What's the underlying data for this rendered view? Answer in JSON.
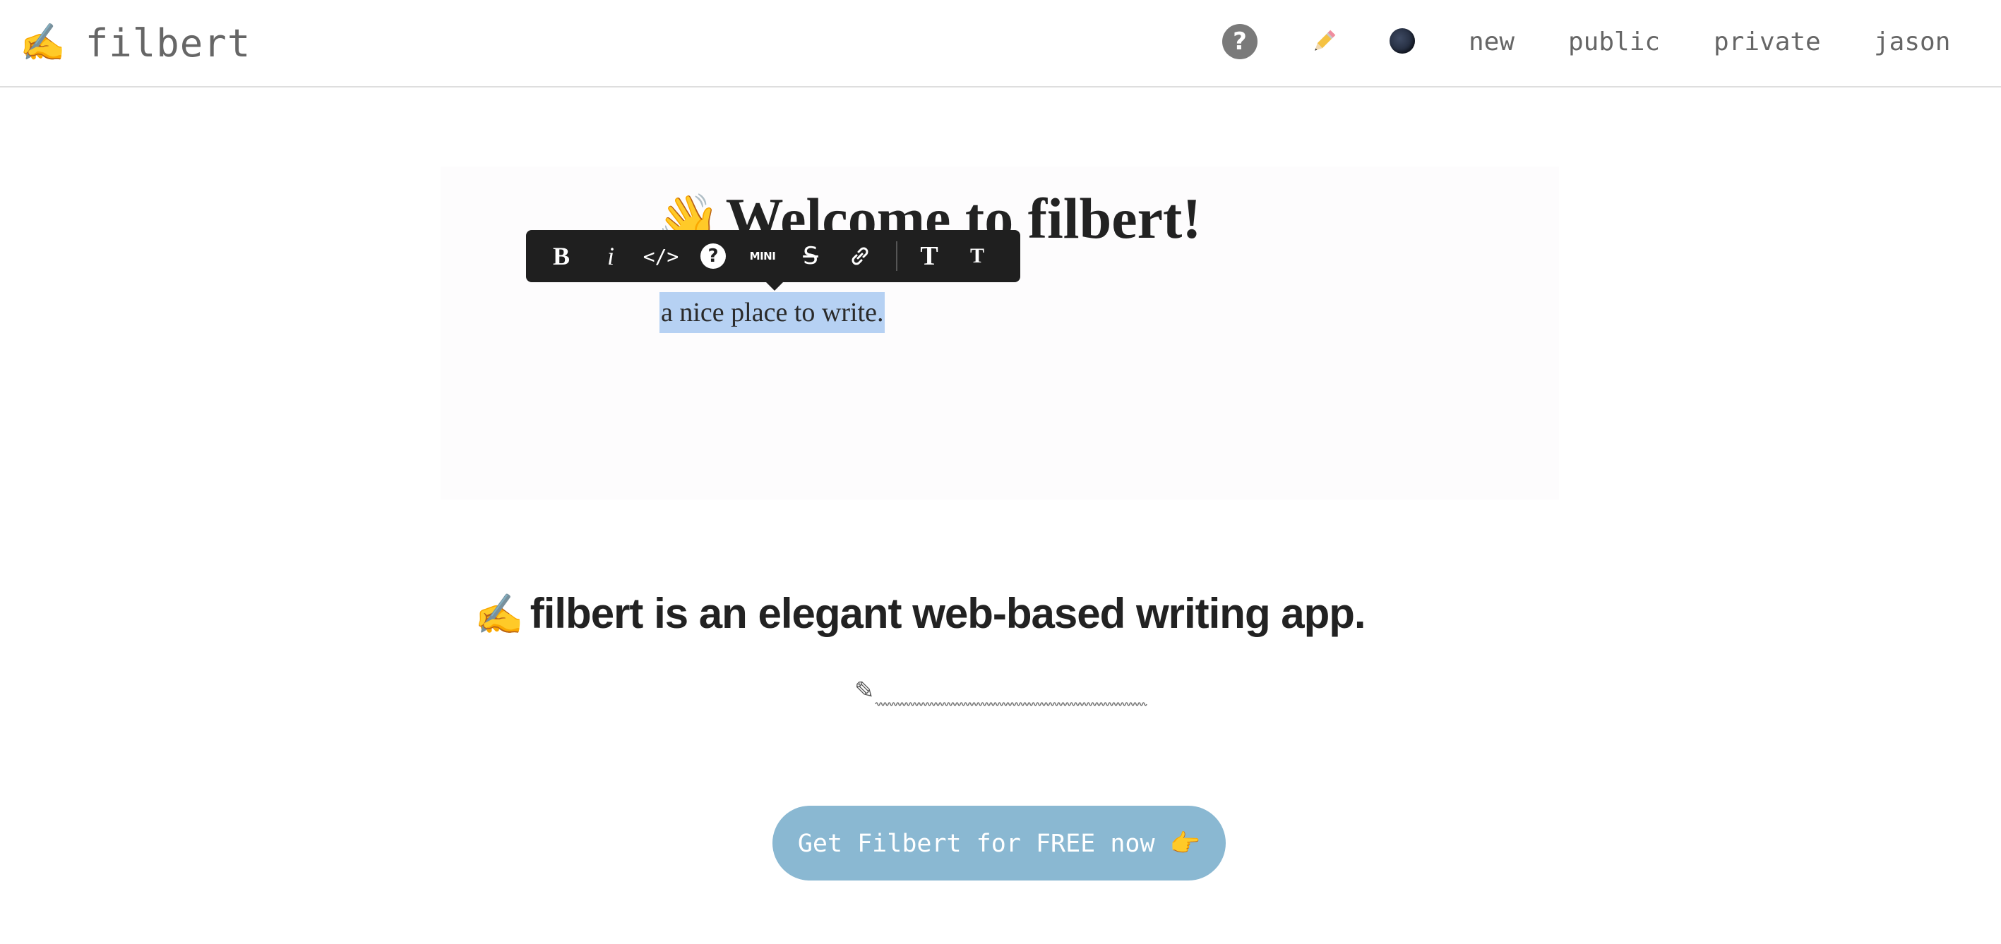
{
  "header": {
    "logo_emoji": "✍️",
    "logo_text": "filbert",
    "help_icon_glyph": "?",
    "pencil_icon_glyph": "✏️",
    "nav": {
      "new": "new",
      "public": "public",
      "private": "private",
      "user": "jason"
    }
  },
  "preview": {
    "title_emoji": "👋",
    "title": "Welcome to filbert!",
    "subtitle": "a nice place to write.",
    "toolbar": {
      "bold": "B",
      "italic": "i",
      "code": "</>",
      "help": "?",
      "mini": "MINI",
      "strike": "S",
      "heading": "T",
      "subheading": "T"
    }
  },
  "tagline": {
    "emoji": "✍️",
    "text": "filbert is an elegant web-based writing app."
  },
  "squiggle_glyph": "✎",
  "cta": {
    "label": "Get Filbert for FREE now 👉"
  },
  "colors": {
    "cta_background": "#8ab8d2",
    "selection_highlight": "#b6d1f3",
    "toolbar_background": "#1f1f1f"
  }
}
